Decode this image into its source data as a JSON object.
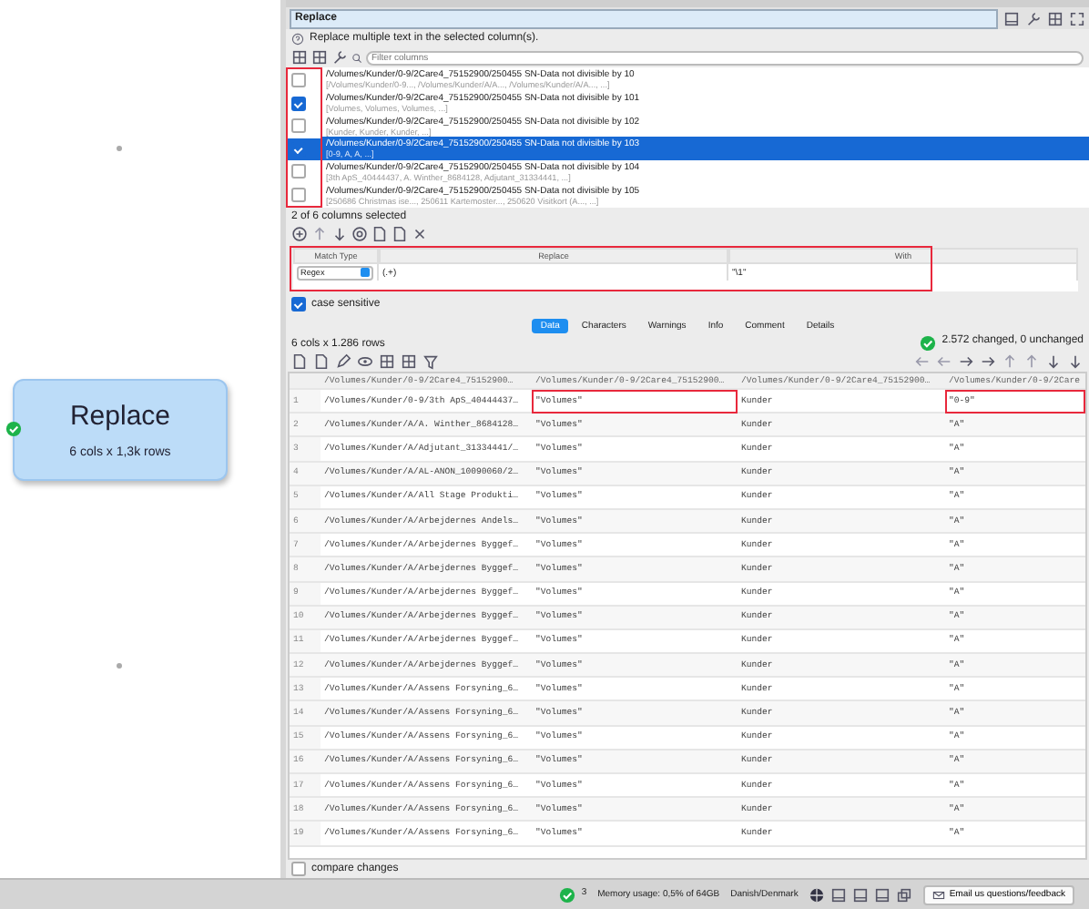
{
  "canvas": {
    "node": {
      "title": "Replace",
      "subtitle": "6 cols x 1,3k rows"
    }
  },
  "dialog": {
    "title": "Replace",
    "description": "Replace multiple text in the selected column(s).",
    "filter": {
      "placeholder": "Filter columns"
    },
    "columns": {
      "highlighted": true,
      "items": [
        {
          "name": "/Volumes/Kunder/0-9/2Care4_75152900/250455 SN-Data not divisible by 10",
          "values": "[/Volumes/Kunder/0-9..., /Volumes/Kunder/A/A..., /Volumes/Kunder/A/A..., ...]",
          "checked": false,
          "selected": false
        },
        {
          "name": "/Volumes/Kunder/0-9/2Care4_75152900/250455 SN-Data not divisible by 101",
          "values": "[Volumes, Volumes, Volumes, ...]",
          "checked": true,
          "selected": false
        },
        {
          "name": "/Volumes/Kunder/0-9/2Care4_75152900/250455 SN-Data not divisible by 102",
          "values": "[Kunder, Kunder, Kunder, ...]",
          "checked": false,
          "selected": false
        },
        {
          "name": "/Volumes/Kunder/0-9/2Care4_75152900/250455 SN-Data not divisible by 103",
          "values": "[0-9, A, A, ...]",
          "checked": true,
          "selected": true
        },
        {
          "name": "/Volumes/Kunder/0-9/2Care4_75152900/250455 SN-Data not divisible by 104",
          "values": "[3th ApS_40444437, A. Winther_8684128, Adjutant_31334441, ...]",
          "checked": false,
          "selected": false
        },
        {
          "name": "/Volumes/Kunder/0-9/2Care4_75152900/250455 SN-Data not divisible by 105",
          "values": "[250686 Christmas ise..., 250611 Kartemoster..., 250620 Visitkort (A..., ...]",
          "checked": false,
          "selected": false
        }
      ]
    },
    "selection_count": "2 of 6 columns selected",
    "rules": {
      "highlighted": true,
      "headers": [
        "Match Type",
        "Replace",
        "With"
      ],
      "rows": [
        {
          "match_type": "Regex",
          "replace": "(.+)",
          "with": "\"\\1\""
        }
      ]
    },
    "case_sensitive": {
      "label": "case sensitive",
      "checked": true
    },
    "tabs": [
      {
        "label": "Data",
        "selected": true
      },
      {
        "label": "Characters",
        "selected": false
      },
      {
        "label": "Warnings",
        "selected": false
      },
      {
        "label": "Info",
        "selected": false
      },
      {
        "label": "Comment",
        "selected": false
      },
      {
        "label": "Details",
        "selected": false
      }
    ],
    "summary": "6 cols x 1.286 rows",
    "result": "2.572 changed, 0 unchanged",
    "table": {
      "columns": [
        "/Volumes/Kunder/0-9/2Care4_75152900…",
        "/Volumes/Kunder/0-9/2Care4_75152900…",
        "/Volumes/Kunder/0-9/2Care4_75152900…",
        "/Volumes/Kunder/0-9/2Care"
      ],
      "rows": [
        {
          "index": "1",
          "cells": [
            {
              "text": "/Volumes/Kunder/0-9/3th ApS_40444437…",
              "highlighted": false
            },
            {
              "text": "\"Volumes\"",
              "highlighted": true
            },
            {
              "text": "Kunder",
              "highlighted": false
            },
            {
              "text": "\"0-9\"",
              "highlighted": true
            }
          ]
        },
        {
          "index": "2",
          "cells": [
            {
              "text": "/Volumes/Kunder/A/A. Winther_8684128…",
              "highlighted": false
            },
            {
              "text": "\"Volumes\"",
              "highlighted": false
            },
            {
              "text": "Kunder",
              "highlighted": false
            },
            {
              "text": "\"A\"",
              "highlighted": false
            }
          ]
        },
        {
          "index": "3",
          "cells": [
            {
              "text": "/Volumes/Kunder/A/Adjutant_31334441/…",
              "highlighted": false
            },
            {
              "text": "\"Volumes\"",
              "highlighted": false
            },
            {
              "text": "Kunder",
              "highlighted": false
            },
            {
              "text": "\"A\"",
              "highlighted": false
            }
          ]
        },
        {
          "index": "4",
          "cells": [
            {
              "text": "/Volumes/Kunder/A/AL-ANON_10090060/2…",
              "highlighted": false
            },
            {
              "text": "\"Volumes\"",
              "highlighted": false
            },
            {
              "text": "Kunder",
              "highlighted": false
            },
            {
              "text": "\"A\"",
              "highlighted": false
            }
          ]
        },
        {
          "index": "5",
          "cells": [
            {
              "text": "/Volumes/Kunder/A/All Stage Produkti…",
              "highlighted": false
            },
            {
              "text": "\"Volumes\"",
              "highlighted": false
            },
            {
              "text": "Kunder",
              "highlighted": false
            },
            {
              "text": "\"A\"",
              "highlighted": false
            }
          ]
        },
        {
          "index": "6",
          "cells": [
            {
              "text": "/Volumes/Kunder/A/Arbejdernes Andels…",
              "highlighted": false
            },
            {
              "text": "\"Volumes\"",
              "highlighted": false
            },
            {
              "text": "Kunder",
              "highlighted": false
            },
            {
              "text": "\"A\"",
              "highlighted": false
            }
          ]
        },
        {
          "index": "7",
          "cells": [
            {
              "text": "/Volumes/Kunder/A/Arbejdernes Byggef…",
              "highlighted": false
            },
            {
              "text": "\"Volumes\"",
              "highlighted": false
            },
            {
              "text": "Kunder",
              "highlighted": false
            },
            {
              "text": "\"A\"",
              "highlighted": false
            }
          ]
        },
        {
          "index": "8",
          "cells": [
            {
              "text": "/Volumes/Kunder/A/Arbejdernes Byggef…",
              "highlighted": false
            },
            {
              "text": "\"Volumes\"",
              "highlighted": false
            },
            {
              "text": "Kunder",
              "highlighted": false
            },
            {
              "text": "\"A\"",
              "highlighted": false
            }
          ]
        },
        {
          "index": "9",
          "cells": [
            {
              "text": "/Volumes/Kunder/A/Arbejdernes Byggef…",
              "highlighted": false
            },
            {
              "text": "\"Volumes\"",
              "highlighted": false
            },
            {
              "text": "Kunder",
              "highlighted": false
            },
            {
              "text": "\"A\"",
              "highlighted": false
            }
          ]
        },
        {
          "index": "10",
          "cells": [
            {
              "text": "/Volumes/Kunder/A/Arbejdernes Byggef…",
              "highlighted": false
            },
            {
              "text": "\"Volumes\"",
              "highlighted": false
            },
            {
              "text": "Kunder",
              "highlighted": false
            },
            {
              "text": "\"A\"",
              "highlighted": false
            }
          ]
        },
        {
          "index": "11",
          "cells": [
            {
              "text": "/Volumes/Kunder/A/Arbejdernes Byggef…",
              "highlighted": false
            },
            {
              "text": "\"Volumes\"",
              "highlighted": false
            },
            {
              "text": "Kunder",
              "highlighted": false
            },
            {
              "text": "\"A\"",
              "highlighted": false
            }
          ]
        },
        {
          "index": "12",
          "cells": [
            {
              "text": "/Volumes/Kunder/A/Arbejdernes Byggef…",
              "highlighted": false
            },
            {
              "text": "\"Volumes\"",
              "highlighted": false
            },
            {
              "text": "Kunder",
              "highlighted": false
            },
            {
              "text": "\"A\"",
              "highlighted": false
            }
          ]
        },
        {
          "index": "13",
          "cells": [
            {
              "text": "/Volumes/Kunder/A/Assens Forsyning_6…",
              "highlighted": false
            },
            {
              "text": "\"Volumes\"",
              "highlighted": false
            },
            {
              "text": "Kunder",
              "highlighted": false
            },
            {
              "text": "\"A\"",
              "highlighted": false
            }
          ]
        },
        {
          "index": "14",
          "cells": [
            {
              "text": "/Volumes/Kunder/A/Assens Forsyning_6…",
              "highlighted": false
            },
            {
              "text": "\"Volumes\"",
              "highlighted": false
            },
            {
              "text": "Kunder",
              "highlighted": false
            },
            {
              "text": "\"A\"",
              "highlighted": false
            }
          ]
        },
        {
          "index": "15",
          "cells": [
            {
              "text": "/Volumes/Kunder/A/Assens Forsyning_6…",
              "highlighted": false
            },
            {
              "text": "\"Volumes\"",
              "highlighted": false
            },
            {
              "text": "Kunder",
              "highlighted": false
            },
            {
              "text": "\"A\"",
              "highlighted": false
            }
          ]
        },
        {
          "index": "16",
          "cells": [
            {
              "text": "/Volumes/Kunder/A/Assens Forsyning_6…",
              "highlighted": false
            },
            {
              "text": "\"Volumes\"",
              "highlighted": false
            },
            {
              "text": "Kunder",
              "highlighted": false
            },
            {
              "text": "\"A\"",
              "highlighted": false
            }
          ]
        },
        {
          "index": "17",
          "cells": [
            {
              "text": "/Volumes/Kunder/A/Assens Forsyning_6…",
              "highlighted": false
            },
            {
              "text": "\"Volumes\"",
              "highlighted": false
            },
            {
              "text": "Kunder",
              "highlighted": false
            },
            {
              "text": "\"A\"",
              "highlighted": false
            }
          ]
        },
        {
          "index": "18",
          "cells": [
            {
              "text": "/Volumes/Kunder/A/Assens Forsyning_6…",
              "highlighted": false
            },
            {
              "text": "\"Volumes\"",
              "highlighted": false
            },
            {
              "text": "Kunder",
              "highlighted": false
            },
            {
              "text": "\"A\"",
              "highlighted": false
            }
          ]
        },
        {
          "index": "19",
          "cells": [
            {
              "text": "/Volumes/Kunder/A/Assens Forsyning_6…",
              "highlighted": false
            },
            {
              "text": "\"Volumes\"",
              "highlighted": false
            },
            {
              "text": "Kunder",
              "highlighted": false
            },
            {
              "text": "\"A\"",
              "highlighted": false
            }
          ]
        }
      ]
    },
    "compare": {
      "label": "compare changes",
      "checked": false
    }
  },
  "status_bar": {
    "problems": "3",
    "memory": "Memory usage: 0,5% of 64GB",
    "locale": "Danish/Denmark",
    "feedback": "Email us questions/feedback"
  }
}
